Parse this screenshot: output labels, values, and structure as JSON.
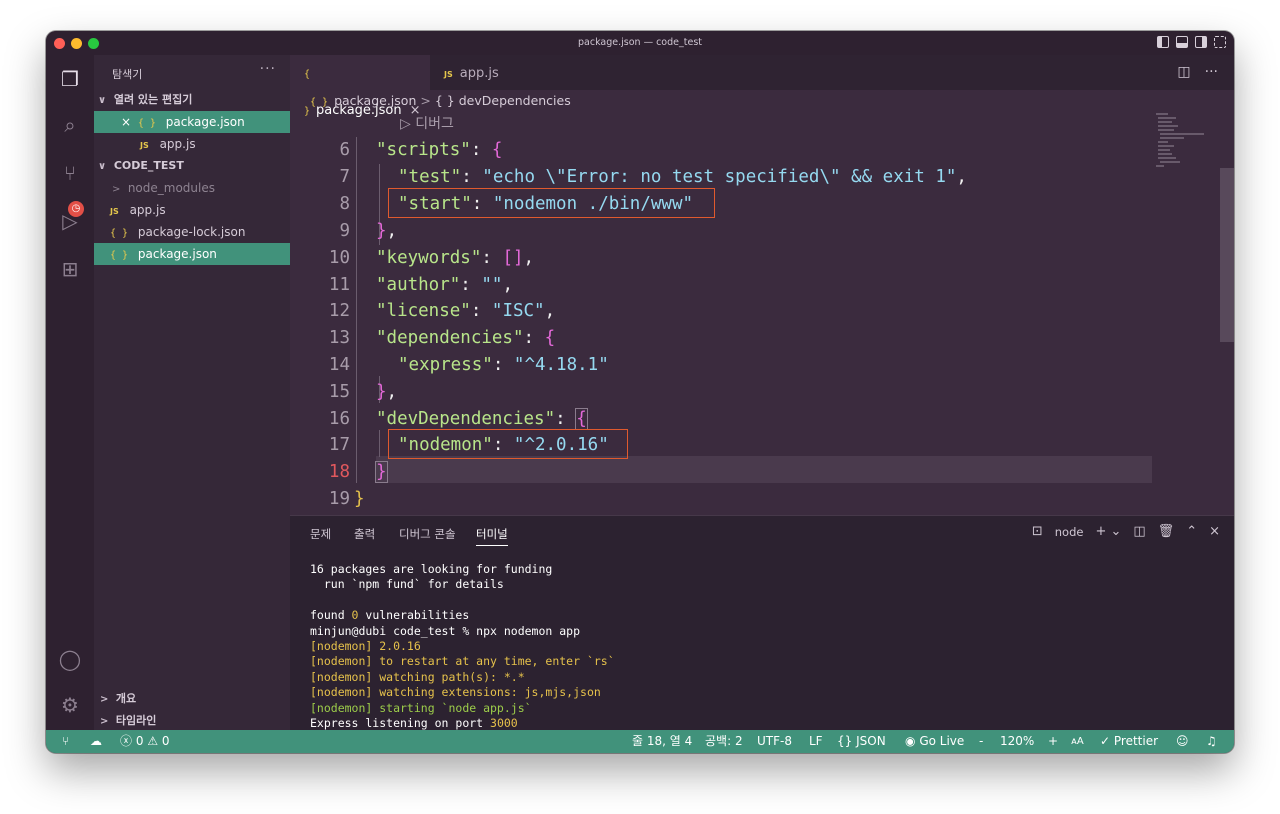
{
  "window": {
    "title": "package.json — code_test"
  },
  "sidebar": {
    "header": "탐색기",
    "more": "···",
    "open_editors_label": "열려 있는 편집기",
    "open_editors": [
      {
        "name": "package.json",
        "icon": "{ }"
      },
      {
        "name": "app.js",
        "icon": "JS"
      }
    ],
    "project_label": "CODE_TEST",
    "files": [
      {
        "name": "node_modules",
        "icon": ">"
      },
      {
        "name": "app.js",
        "icon": "JS"
      },
      {
        "name": "package-lock.json",
        "icon": "{ }"
      },
      {
        "name": "package.json",
        "icon": "{ }"
      }
    ],
    "outline_label": "개요",
    "timeline_label": "타임라인"
  },
  "tabs": [
    {
      "label": "package.json",
      "icon": "{ }",
      "close": "×"
    },
    {
      "label": "app.js",
      "icon": "JS"
    }
  ],
  "breadcrumb": {
    "file": "package.json",
    "icon": "{ }",
    "section": "devDependencies",
    "section_icon": "{ }"
  },
  "editor": {
    "codelens": "▷ 디버그",
    "line_numbers": [
      "6",
      "7",
      "8",
      "9",
      "10",
      "11",
      "12",
      "13",
      "14",
      "15",
      "16",
      "17",
      "18",
      "19"
    ],
    "lines": {
      "l6": {
        "key": "\"scripts\"",
        "colon": ": ",
        "open": "{"
      },
      "l7": {
        "key": "\"test\"",
        "colon": ": ",
        "val": "\"echo \\\"Error: no test specified\\\" && exit 1\"",
        "comma": ","
      },
      "l8": {
        "key": "\"start\"",
        "colon": ": ",
        "val": "\"nodemon ./bin/www\""
      },
      "l9": {
        "close": "}",
        "comma": ","
      },
      "l10": {
        "key": "\"keywords\"",
        "colon": ": ",
        "val": "[]",
        "comma": ","
      },
      "l11": {
        "key": "\"author\"",
        "colon": ": ",
        "val": "\"\"",
        "comma": ","
      },
      "l12": {
        "key": "\"license\"",
        "colon": ": ",
        "val": "\"ISC\"",
        "comma": ","
      },
      "l13": {
        "key": "\"dependencies\"",
        "colon": ": ",
        "open": "{"
      },
      "l14": {
        "key": "\"express\"",
        "colon": ": ",
        "val": "\"^4.18.1\""
      },
      "l15": {
        "close": "}",
        "comma": ","
      },
      "l16": {
        "key": "\"devDependencies\"",
        "colon": ": ",
        "open": "{"
      },
      "l17": {
        "key": "\"nodemon\"",
        "colon": ": ",
        "val": "\"^2.0.16\""
      },
      "l18": {
        "close": "}"
      },
      "l19": {
        "close": "}"
      }
    }
  },
  "panel": {
    "tabs": [
      "문제",
      "출력",
      "디버그 콘솔",
      "터미널"
    ],
    "terminal_name": "node",
    "terminal": {
      "l1": "16 packages are looking for funding",
      "l2": "  run `npm fund` for details",
      "l3a": "found ",
      "l3b": "0",
      "l3c": " vulnerabilities",
      "l4": "minjun@dubi code_test % npx nodemon app",
      "l5": "[nodemon] 2.0.16",
      "l6": "[nodemon] to restart at any time, enter `rs`",
      "l7": "[nodemon] watching path(s): *.*",
      "l8": "[nodemon] watching extensions: js,mjs,json",
      "l9": "[nodemon] starting `node app.js`",
      "l10a": "Express listening on port ",
      "l10b": "3000"
    }
  },
  "status": {
    "errors": "0",
    "warnings": "0",
    "position": "줄 18, 열 4",
    "spaces": "공백: 2",
    "encoding": "UTF-8",
    "eol": "LF",
    "language": "JSON",
    "golive": "Go Live",
    "zoom_minus": "-",
    "zoom": "120%",
    "zoom_plus": "+",
    "font_size": "ᴀA",
    "prettier": "Prettier"
  },
  "colors": {
    "accent": "#41927b",
    "background": "#3b2b3e",
    "highlight_box": "#e05a2e"
  }
}
